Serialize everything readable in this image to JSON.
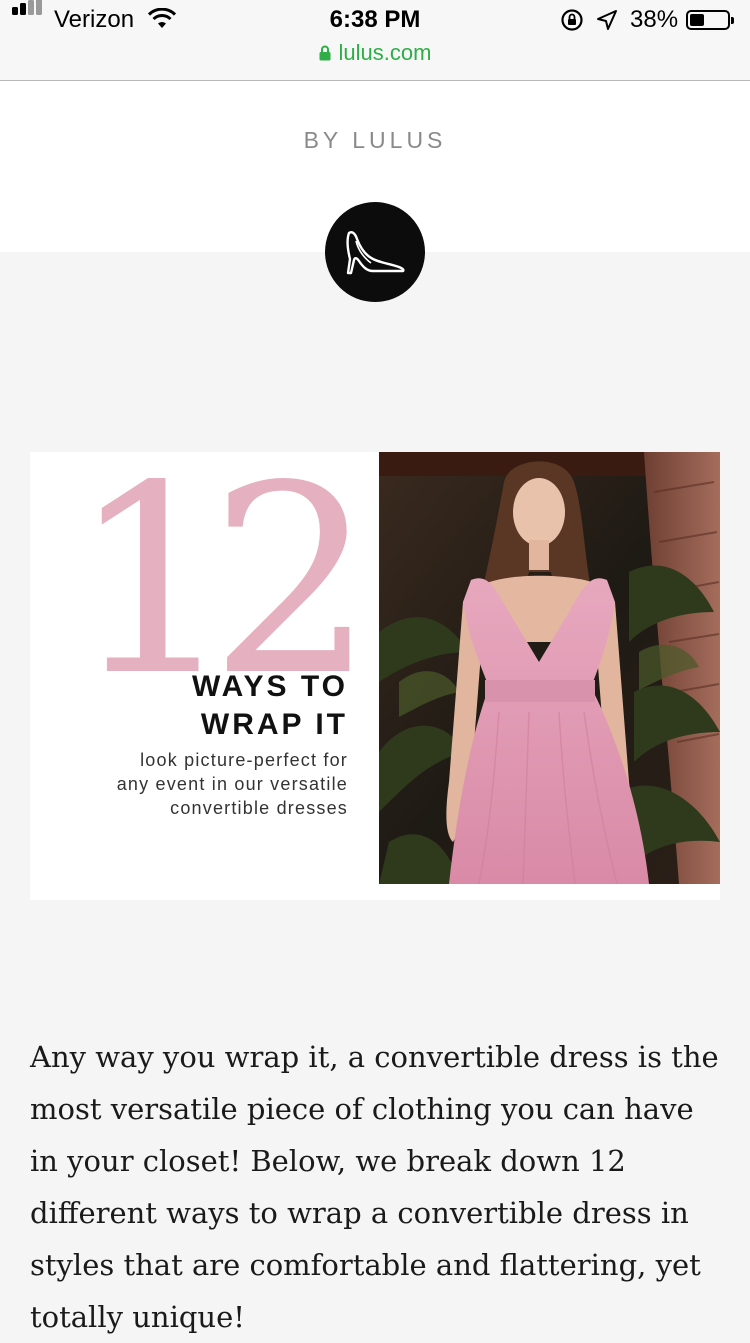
{
  "status_bar": {
    "carrier": "Verizon",
    "time": "6:38 PM",
    "battery_percent": "38%",
    "battery_level": 0.38
  },
  "browser": {
    "url": "lulus.com",
    "secure": true
  },
  "header": {
    "byline": "BY LULUS",
    "badge_icon": "high-heel-shoe-icon"
  },
  "hero": {
    "number": "12",
    "title_line1": "WAYS TO",
    "title_line2": "WRAP IT",
    "subtitle_line1": "look picture-perfect for",
    "subtitle_line2": "any event in our versatile",
    "subtitle_line3": "convertible dresses",
    "accent_color": "#e5b0bf",
    "dress_color": "#e29bb4"
  },
  "article": {
    "intro": "Any way you wrap it, a convertible dress is the most versatile piece of clothing you can have in your closet! Below, we break down 12 different ways to wrap a convertible dress in styles that are comfortable and flattering, yet totally unique!"
  }
}
